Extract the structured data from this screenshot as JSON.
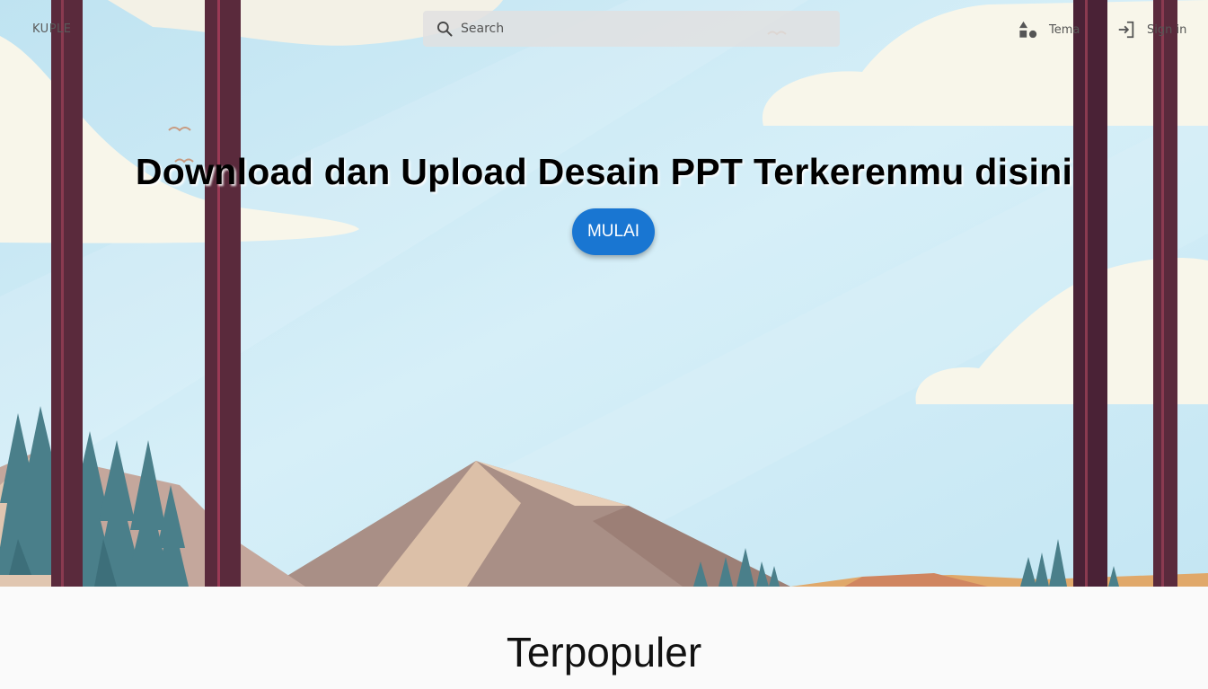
{
  "app": {
    "logo": "KUPLE"
  },
  "search": {
    "placeholder": "Search",
    "value": ""
  },
  "nav": {
    "tema": {
      "label": "Tema",
      "icon": "shapes-icon"
    },
    "signin": {
      "label": "Sign in",
      "icon": "login-icon"
    }
  },
  "hero": {
    "headline": "Download dan Upload Desain PPT Terkerenmu disini",
    "cta_label": "MULAI"
  },
  "section": {
    "title": "Terpopuler"
  },
  "colors": {
    "accent": "#1976d2",
    "sky": "#c9e9f4",
    "trunk": "#5a2a3c",
    "page_bg": "#fafafa"
  }
}
